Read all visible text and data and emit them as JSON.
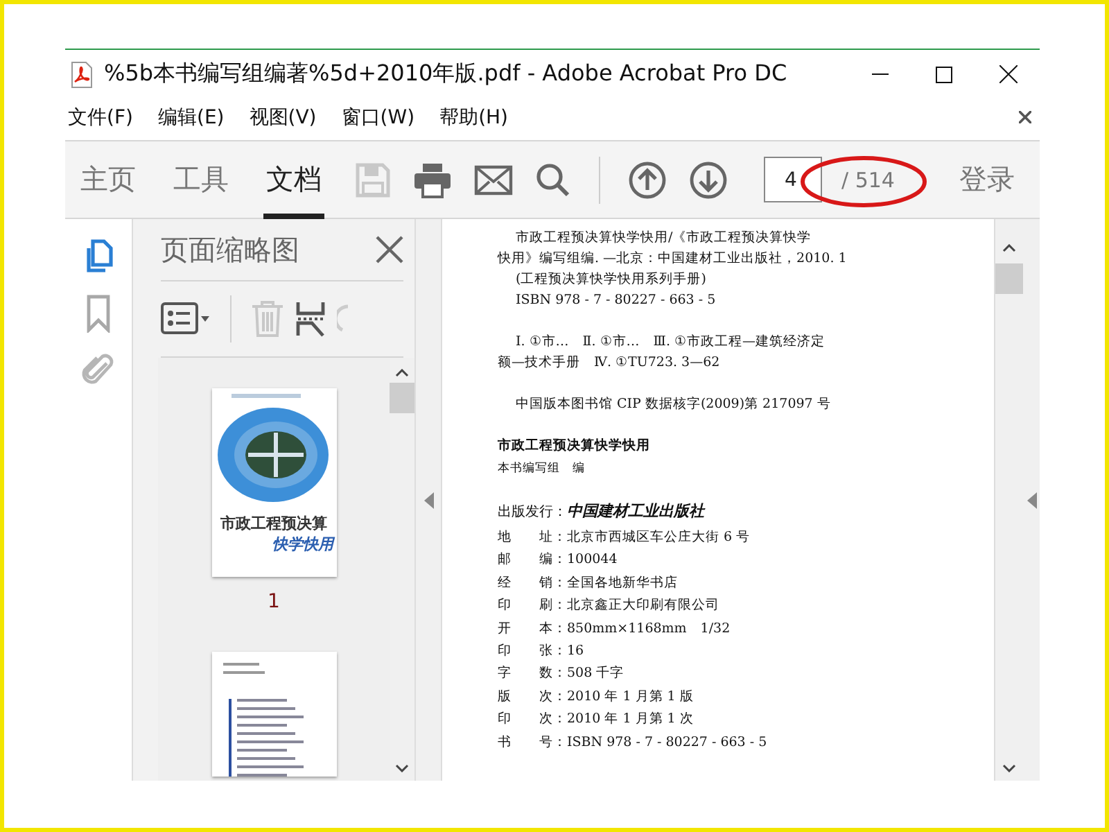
{
  "window": {
    "title": "%5b本书编写组编著%5d+2010年版.pdf - Adobe Acrobat Pro DC"
  },
  "menu": [
    {
      "label": "文件(F)"
    },
    {
      "label": "编辑(E)"
    },
    {
      "label": "视图(V)"
    },
    {
      "label": "窗口(W)"
    },
    {
      "label": "帮助(H)"
    }
  ],
  "tabs": [
    {
      "label": "主页",
      "selected": false
    },
    {
      "label": "工具",
      "selected": false
    },
    {
      "label": "文档",
      "selected": true
    }
  ],
  "page_nav": {
    "value": "4",
    "total": "/ 514"
  },
  "login": "登录",
  "sidebar": {
    "items": [
      {
        "kind": "pages",
        "selected": true
      },
      {
        "kind": "bookmark",
        "selected": false
      },
      {
        "kind": "attachment",
        "selected": false
      }
    ]
  },
  "thumbnail_panel": {
    "title": "页面缩略图",
    "thumbnails": [
      {
        "kind": "cover",
        "title": "市政工程预决算",
        "subtitle": "快学快用",
        "page": "1"
      },
      {
        "kind": "contents"
      }
    ]
  },
  "document": {
    "groups": [
      {
        "lines": [
          {
            "kind": "indent",
            "text": "市政工程预决算快学快用/《市政工程预决算快学"
          },
          {
            "kind": "plain",
            "text": "快用》编写组编. —北京：中国建材工业出版社，2010. 1"
          },
          {
            "kind": "indent",
            "text": "(工程预决算快学快用系列手册)"
          },
          {
            "kind": "indent",
            "text": "ISBN 978 - 7 - 80227 - 663 - 5"
          }
        ]
      },
      {
        "lines": [
          {
            "kind": "indent",
            "text": "Ⅰ. ①市…　Ⅱ. ①市…　Ⅲ. ①市政工程—建筑经济定"
          },
          {
            "kind": "plain",
            "text": "额—技术手册　Ⅳ. ①TU723. 3—62"
          }
        ]
      },
      {
        "lines": [
          {
            "kind": "indent",
            "text": "中国版本图书馆 CIP 数据核字(2009)第 217097 号"
          }
        ]
      },
      {
        "lines": [
          {
            "kind": "title",
            "text": "市政工程预决算快学快用"
          },
          {
            "kind": "small",
            "text": "本书编写组　编"
          }
        ]
      },
      {
        "lines": [
          {
            "kind": "publisher",
            "label": "出版发行：",
            "value": "中国建材工业出版社"
          },
          {
            "kind": "field",
            "label": "地　　址：",
            "value": "北京市西城区车公庄大街 6 号"
          },
          {
            "kind": "field",
            "label": "邮　　编：",
            "value": "100044"
          },
          {
            "kind": "field",
            "label": "经　　销：",
            "value": "全国各地新华书店"
          },
          {
            "kind": "field",
            "label": "印　　刷：",
            "value": "北京鑫正大印刷有限公司"
          },
          {
            "kind": "field",
            "label": "开　　本：",
            "value": "850mm×1168mm　1/32"
          },
          {
            "kind": "field",
            "label": "印　　张：",
            "value": "16"
          },
          {
            "kind": "field",
            "label": "字　　数：",
            "value": "508 千字"
          },
          {
            "kind": "field",
            "label": "版　　次：",
            "value": "2010 年 1 月第 1 版"
          },
          {
            "kind": "field",
            "label": "印　　次：",
            "value": "2010 年 1 月第 1 次"
          },
          {
            "kind": "field",
            "label": "书　　号：",
            "value": "ISBN 978 - 7 - 80227 - 663 - 5"
          }
        ]
      }
    ]
  }
}
